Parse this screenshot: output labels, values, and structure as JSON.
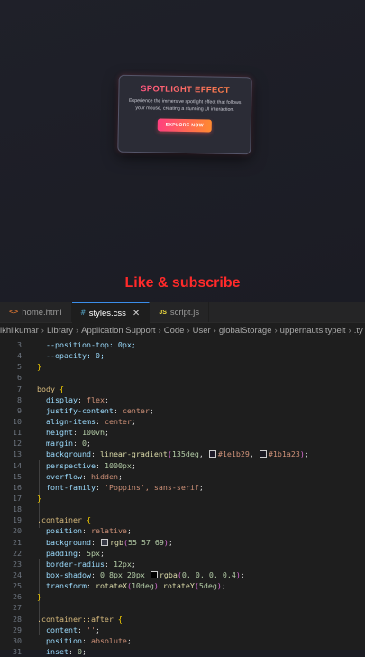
{
  "preview": {
    "card": {
      "title": "SPOTLIGHT EFFECT",
      "description": "Experience the immersive spotlight effect that follows your mouse, creating a stunning UI interaction.",
      "button_label": "EXPLORE NOW"
    },
    "overlay_text": "Like & subscribe"
  },
  "editor": {
    "tabs": [
      {
        "label": "home.html",
        "icon": "html-file-icon",
        "glyph": "<>",
        "active": false
      },
      {
        "label": "styles.css",
        "icon": "css-file-icon",
        "glyph": "#",
        "active": true
      },
      {
        "label": "script.js",
        "icon": "js-file-icon",
        "glyph": "JS",
        "active": false
      }
    ],
    "breadcrumb": [
      "ikhilkumar",
      "Library",
      "Application Support",
      "Code",
      "User",
      "globalStorage",
      "uppernauts.typeit",
      ".ty"
    ],
    "line_numbers": [
      "3",
      "4",
      "5",
      "6",
      "7",
      "8",
      "9",
      "10",
      "11",
      "12",
      "13",
      "14",
      "15",
      "16",
      "17",
      "18",
      "19",
      "20",
      "21",
      "22",
      "23",
      "24",
      "25",
      "26",
      "27",
      "28",
      "29",
      "30",
      "31"
    ],
    "code": {
      "l3": "--position-top: 0px;",
      "l4": "--opacity: 0;",
      "l5": "}",
      "l7_sel": "body",
      "l8_p": "display",
      "l8_v": "flex",
      "l9_p": "justify-content",
      "l9_v": "center",
      "l10_p": "align-items",
      "l10_v": "center",
      "l11_p": "height",
      "l11_v": "100vh",
      "l12_p": "margin",
      "l12_v": "0",
      "l13_p": "background",
      "l13_fn": "linear-gradient",
      "l13_a": "135deg",
      "l13_c1": "#1e1b29",
      "l13_c2": "#1b1a23",
      "l14_p": "perspective",
      "l14_v": "1000px",
      "l15_p": "overflow",
      "l15_v": "hidden",
      "l16_p": "font-family",
      "l16_v": "'Poppins', sans-serif",
      "l20_sel": ".container",
      "l21_p": "position",
      "l21_v": "relative",
      "l22_p": "background",
      "l22_fn": "rgb",
      "l22_v": "55 57 69",
      "l23_p": "padding",
      "l23_v": "5px",
      "l24_p": "border-radius",
      "l24_v": "12px",
      "l25_p": "box-shadow",
      "l25_v": "0 8px 20px",
      "l25_fn": "rgba",
      "l25_args": "0, 0, 0, 0.4",
      "l26_p": "transform",
      "l26_fn1": "rotateX",
      "l26_a1": "10deg",
      "l26_fn2": "rotateY",
      "l26_a2": "5deg",
      "l28_sel": ".container::after",
      "l29_p": "content",
      "l29_v": "''",
      "l30_p": "position",
      "l30_v": "absolute",
      "l31_p": "inset",
      "l31_v": "0"
    },
    "colors": {
      "swatch_1": "#1e1b29",
      "swatch_2": "#1b1a23",
      "swatch_3": "#373945",
      "swatch_4": "#000000"
    }
  }
}
